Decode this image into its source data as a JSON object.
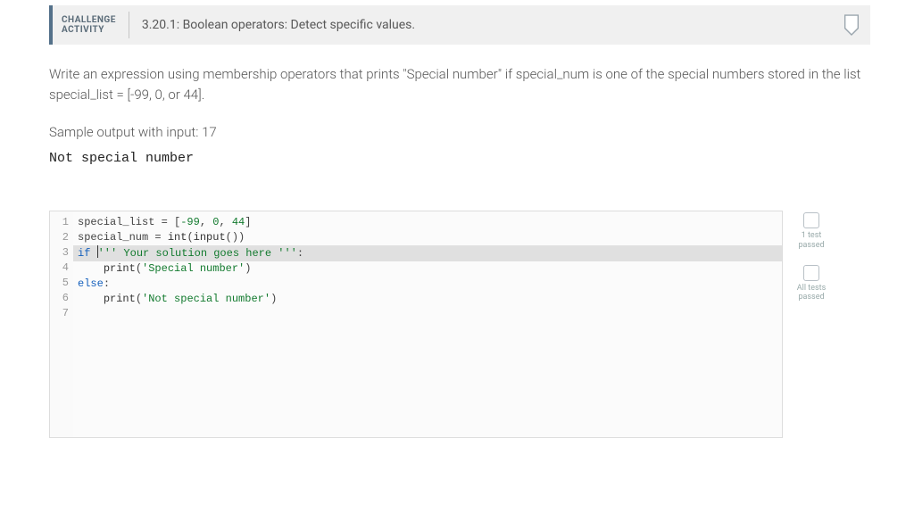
{
  "header": {
    "challenge_label_1": "CHALLENGE",
    "challenge_label_2": "ACTIVITY",
    "title": "3.20.1: Boolean operators: Detect specific values."
  },
  "instructions": "Write an expression using membership operators that prints \"Special number\" if special_num is one of the special numbers stored in the list special_list = [-99, 0, or 44].",
  "sample_label": "Sample output with input: 17",
  "sample_output": "Not special number",
  "code": {
    "lines": [
      {
        "n": "1",
        "raw": "special_list = [-99, 0, 44]"
      },
      {
        "n": "2",
        "raw": "special_num = int(input())"
      },
      {
        "n": "3",
        "raw": ""
      },
      {
        "n": "4",
        "raw": "if ''' Your solution goes here ''':",
        "active": true
      },
      {
        "n": "5",
        "raw": "    print('Special number')"
      },
      {
        "n": "6",
        "raw": "else:"
      },
      {
        "n": "7",
        "raw": "    print('Not special number')"
      }
    ]
  },
  "tests": [
    {
      "label1": "1 test",
      "label2": "passed"
    },
    {
      "label1": "All tests",
      "label2": "passed"
    }
  ]
}
